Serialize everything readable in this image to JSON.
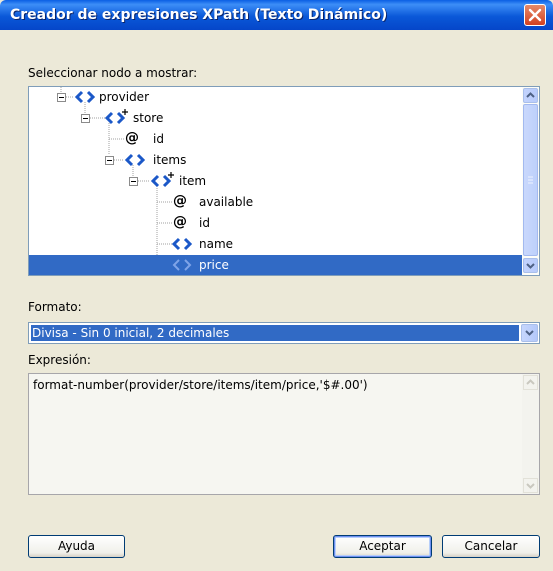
{
  "window": {
    "title": "Creador de expresiones XPath (Texto Dinámico)"
  },
  "tree": {
    "label": "Seleccionar nodo a mostrar:",
    "nodes": [
      {
        "label": "provider"
      },
      {
        "label": "store"
      },
      {
        "label": "id"
      },
      {
        "label": "items"
      },
      {
        "label": "item"
      },
      {
        "label": "available"
      },
      {
        "label": "id"
      },
      {
        "label": "name"
      },
      {
        "label": "price"
      }
    ]
  },
  "format": {
    "label": "Formato:",
    "value": "Divisa - Sin 0 inicial, 2 decimales"
  },
  "expression": {
    "label": "Expresión:",
    "value": "format-number(provider/store/items/item/price,'$#.00')"
  },
  "buttons": {
    "help": "Ayuda",
    "ok": "Aceptar",
    "cancel": "Cancelar"
  },
  "colors": {
    "selection": "#316ac5",
    "titlebar": "#0a58d8",
    "dialog": "#ece9d8"
  }
}
